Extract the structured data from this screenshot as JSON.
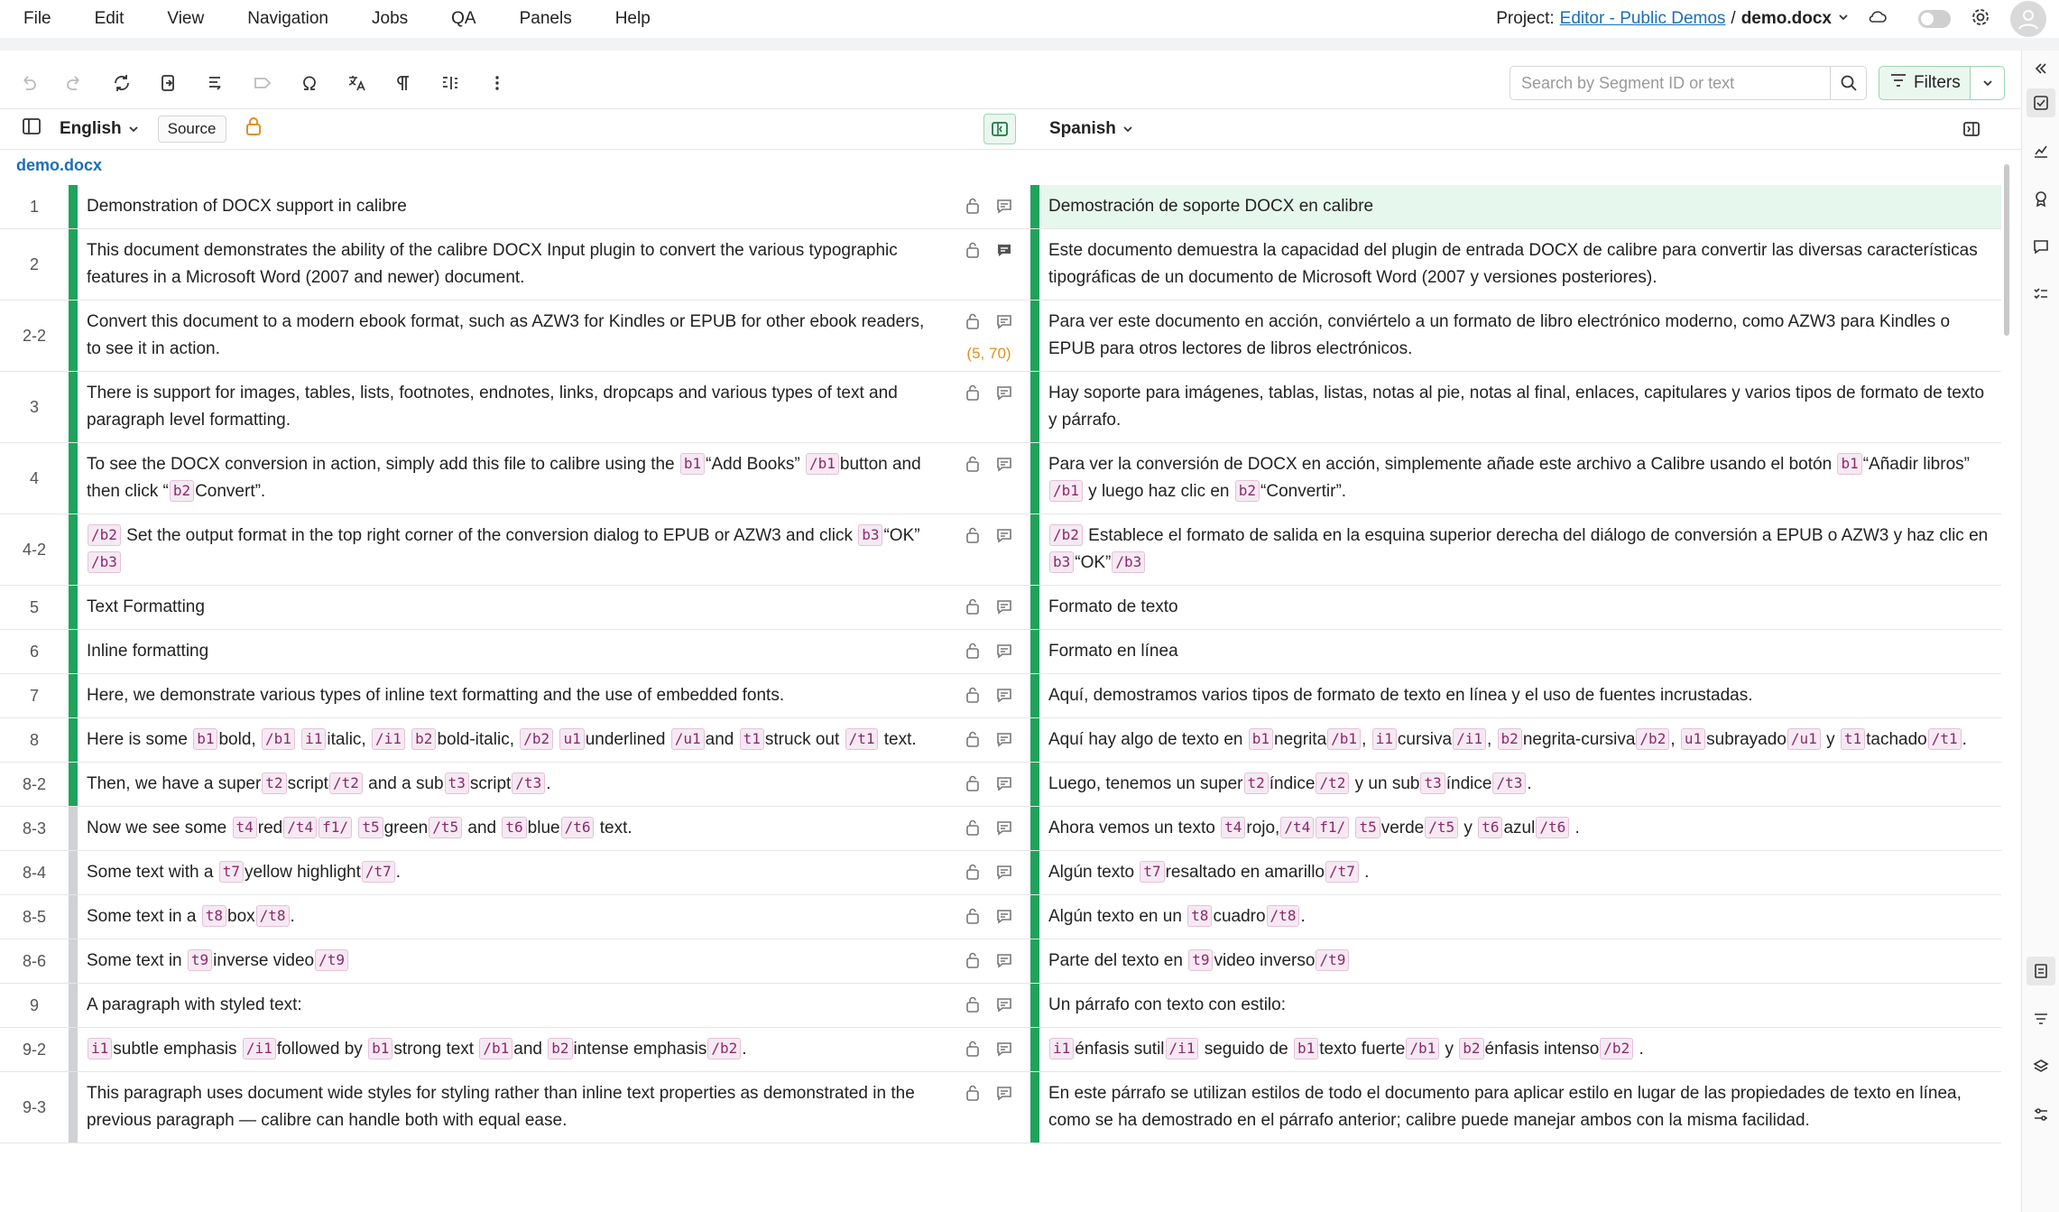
{
  "menu": [
    "File",
    "Edit",
    "View",
    "Navigation",
    "Jobs",
    "QA",
    "Panels",
    "Help"
  ],
  "project": {
    "label": "Project:",
    "name": "Editor - Public Demos",
    "slash": "/",
    "file": "demo.docx"
  },
  "search": {
    "placeholder": "Search by Segment ID or text",
    "value": ""
  },
  "filters_label": "Filters",
  "source_lang": "English",
  "source_btn": "Source",
  "target_lang": "Spanish",
  "file_name": "demo.docx",
  "segments": [
    {
      "id": "1",
      "src": "Demonstration of DOCX support in calibre",
      "tgt": "Demostración de soporte DOCX en calibre",
      "active": true
    },
    {
      "id": "2",
      "src": "This document demonstrates the ability of the calibre DOCX Input plugin to convert the various typographic features in a Microsoft Word (2007 and newer) document.",
      "tgt": "Este documento demuestra la capacidad del plugin de entrada DOCX de calibre para convertir las diversas características tipográficas de un documento de Microsoft Word (2007 y versiones posteriores).",
      "comment": true
    },
    {
      "id": "2-2",
      "src": "Convert this document to a modern ebook format, such as AZW3 for Kindles or EPUB for other ebook readers, to see it in action.",
      "tgt": "Para ver este documento en acción, conviértelo a un formato de libro electrónico moderno, como AZW3 para Kindles o EPUB para otros lectores de libros electrónicos.",
      "pos": "(5, 70)"
    },
    {
      "id": "3",
      "src": "There is support for images, tables, lists, footnotes, endnotes, links, dropcaps and various types of text and paragraph level formatting.",
      "tgt": "Hay soporte para imágenes, tablas, listas, notas al pie, notas al final, enlaces, capitulares y varios tipos de formato de texto y párrafo."
    },
    {
      "id": "4",
      "src": "To see the DOCX conversion in action, simply add this file to calibre using the [[b1]]“Add Books” [[/b1]]button and then click “[[b2]]Convert”.",
      "tgt": "Para ver la conversión de DOCX en acción, simplemente añade este archivo a Calibre usando el botón [[b1]]“Añadir libros” [[/b1]] y luego haz clic en [[b2]]“Convertir”."
    },
    {
      "id": "4-2",
      "src": "[[/b2]] Set the output format in the top right corner of the conversion dialog to EPUB or AZW3 and click [[b3]]“OK”[[/b3]]",
      "tgt": "[[/b2]] Establece el formato de salida en la esquina superior derecha del diálogo de conversión a EPUB o AZW3 y haz clic en [[b3]]“OK”[[/b3]]"
    },
    {
      "id": "5",
      "src": "Text Formatting",
      "tgt": "Formato de texto"
    },
    {
      "id": "6",
      "src": "Inline formatting",
      "tgt": "Formato en línea"
    },
    {
      "id": "7",
      "src": "Here, we demonstrate various types of inline text formatting and the use of embedded fonts.",
      "tgt": "Aquí, demostramos varios tipos de formato de texto en línea y el uso de fuentes incrustadas."
    },
    {
      "id": "8",
      "src": "Here is some [[b1]]bold, [[/b1]] [[i1]]italic, [[/i1]] [[b2]]bold-italic, [[/b2]] [[u1]]underlined [[/u1]]and [[t1]]struck out [[/t1]] text.",
      "tgt": "Aquí hay algo de texto en [[b1]]negrita[[/b1]], [[i1]]cursiva[[/i1]], [[b2]]negrita-cursiva[[/b2]], [[u1]]subrayado[[/u1]] y [[t1]]tachado[[/t1]]."
    },
    {
      "id": "8-2",
      "src": "Then, we have a super[[t2]]script[[/t2]] and a sub[[t3]]script[[/t3]].",
      "tgt": "Luego, tenemos un super[[t2]]índice[[/t2]] y un sub[[t3]]índice[[/t3]]."
    },
    {
      "id": "8-3",
      "src": "Now we see some [[t4]]red[[/t4]][[f1/]] [[t5]]green[[/t5]] and [[t6]]blue[[/t6]] text.",
      "tgt": "Ahora vemos un texto [[t4]]rojo,[[/t4]][[f1/]] [[t5]]verde[[/t5]] y [[t6]]azul[[/t6]] .",
      "grey": true
    },
    {
      "id": "8-4",
      "src": "Some text with a [[t7]]yellow highlight[[/t7]].",
      "tgt": "Algún texto [[t7]]resaltado en amarillo[[/t7]] .",
      "grey": true
    },
    {
      "id": "8-5",
      "src": "Some text in a [[t8]]box[[/t8]].",
      "tgt": "Algún texto en un [[t8]]cuadro[[/t8]].",
      "grey": true
    },
    {
      "id": "8-6",
      "src": "Some text in [[t9]]inverse video[[/t9]]",
      "tgt": "Parte del texto en [[t9]]video inverso[[/t9]]",
      "grey": true
    },
    {
      "id": "9",
      "src": "A paragraph with styled text:",
      "tgt": "Un párrafo con texto con estilo:",
      "grey": true
    },
    {
      "id": "9-2",
      "src": "[[i1]]subtle emphasis [[/i1]]followed by [[b1]]strong text [[/b1]]and [[b2]]intense emphasis[[/b2]].",
      "tgt": "[[i1]]énfasis sutil[[/i1]] seguido de [[b1]]texto fuerte[[/b1]] y [[b2]]énfasis intenso[[/b2]] .",
      "grey": true
    },
    {
      "id": "9-3",
      "src": "This paragraph uses document wide styles for styling rather than inline text properties as demonstrated in the previous paragraph — calibre can handle both with equal ease.",
      "tgt": "En este párrafo se utilizan estilos de todo el documento para aplicar estilo en lugar de las propiedades de texto en línea, como se ha demostrado en el párrafo anterior; calibre puede manejar ambos con la misma facilidad.",
      "grey": true
    }
  ]
}
